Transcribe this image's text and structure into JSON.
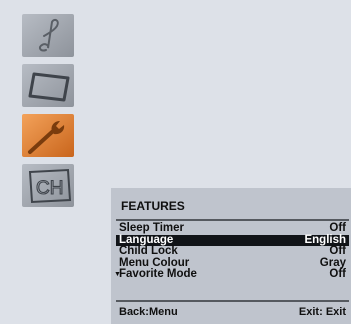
{
  "sidebar": {
    "icons": [
      {
        "name": "music-note-icon"
      },
      {
        "name": "tv-screen-icon"
      },
      {
        "name": "wrench-icon"
      },
      {
        "name": "channel-ch-icon",
        "text": "CH"
      }
    ]
  },
  "menu": {
    "title": "FEATURES",
    "items": [
      {
        "label": "Sleep Timer",
        "value": "Off"
      },
      {
        "label": "Language",
        "value": "English"
      },
      {
        "label": "Child Lock",
        "value": "Off"
      },
      {
        "label": "Menu Colour",
        "value": "Gray"
      },
      {
        "label": "Favorite Mode",
        "value": "Off"
      }
    ],
    "selected_index": 1,
    "footer": {
      "back": "Back:Menu",
      "exit": "Exit: Exit"
    }
  },
  "colors": {
    "background": "#dde1e8",
    "panel": "#bfc4cd",
    "selected_row": "#111418",
    "active_icon": "#e07d2a"
  }
}
